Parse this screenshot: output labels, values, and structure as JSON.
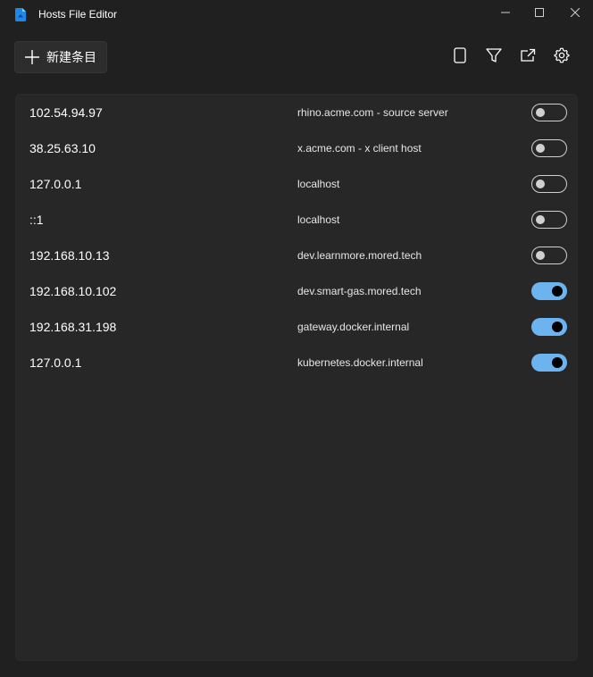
{
  "window": {
    "title": "Hosts File Editor",
    "icons": {
      "app": "hosts-file-icon",
      "minimize": "minimize-icon",
      "maximize": "maximize-icon",
      "close": "close-icon"
    }
  },
  "toolbar": {
    "new_entry_label": "新建条目",
    "icons": [
      "plus-icon",
      "file-icon",
      "filter-icon",
      "open-external-icon",
      "gear-icon"
    ]
  },
  "colors": {
    "background": "#202020",
    "panel": "#272727",
    "accent": "#6cb4f0"
  },
  "entries": [
    {
      "ip": "102.54.94.97",
      "host": "rhino.acme.com - source server",
      "active": false
    },
    {
      "ip": "38.25.63.10",
      "host": "x.acme.com - x client host",
      "active": false
    },
    {
      "ip": "127.0.0.1",
      "host": "localhost",
      "active": false
    },
    {
      "ip": "::1",
      "host": "localhost",
      "active": false
    },
    {
      "ip": "192.168.10.13",
      "host": "dev.learnmore.mored.tech",
      "active": false
    },
    {
      "ip": "192.168.10.102",
      "host": "dev.smart-gas.mored.tech",
      "active": true
    },
    {
      "ip": "192.168.31.198",
      "host": "gateway.docker.internal",
      "active": true
    },
    {
      "ip": "127.0.0.1",
      "host": "kubernetes.docker.internal",
      "active": true
    }
  ]
}
